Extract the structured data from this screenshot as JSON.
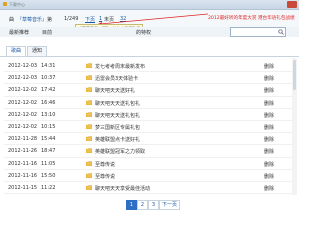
{
  "window": {
    "title": "下载中心"
  },
  "toolbar": {
    "category": "曲",
    "tag": "『草莓音乐』",
    "tag_suffix": "第",
    "page_text": "1/249",
    "prev": "下页",
    "next": "1",
    "last": "末页",
    "last_num": "32"
  },
  "annotation": {
    "red_note": "2012最好听的年度大赏 港台华语礼包战绩",
    "tooltip": "『草莓音乐』第1...单曲人民币购买"
  },
  "nav": {
    "left": "最新推荐",
    "middle": "目前",
    "right": "的特权"
  },
  "search": {
    "placeholder": ""
  },
  "tabs": [
    {
      "label": "歌曲"
    },
    {
      "label": "通知"
    }
  ],
  "rows": [
    {
      "date": "2012-12-03",
      "time": "14:31",
      "title": "龙七考考周末最新发布",
      "action": "删除"
    },
    {
      "date": "2012-12-03",
      "time": "10:37",
      "title": "迅雷会员3天体验卡",
      "action": "删除"
    },
    {
      "date": "2012-12-02",
      "time": "17:42",
      "title": "聊天吧天天送好礼",
      "action": "删除"
    },
    {
      "date": "2012-12-02",
      "time": "16:46",
      "title": "聊天吧天天送礼包礼",
      "action": "删除"
    },
    {
      "date": "2012-12-02",
      "time": "13:10",
      "title": "聊天吧天天送礼包礼",
      "action": "删除"
    },
    {
      "date": "2012-12-02",
      "time": "10:15",
      "title": "梦三国新区专属礼包",
      "action": "删除"
    },
    {
      "date": "2012-11-28",
      "time": "15:44",
      "title": "英雄联盟点卡送好礼",
      "action": "删除"
    },
    {
      "date": "2012-11-26",
      "time": "18:47",
      "title": "英雄联盟冠军之力领取",
      "action": "删除"
    },
    {
      "date": "2012-11-16",
      "time": "11:05",
      "title": "至尊传说",
      "action": "删除"
    },
    {
      "date": "2012-11-16",
      "time": "15:50",
      "title": "至尊传说",
      "action": "删除"
    },
    {
      "date": "2012-11-15",
      "time": "11:22",
      "title": "聊天吧天天享受最佳活动",
      "action": "删除"
    }
  ],
  "pagination": {
    "pages": [
      "1",
      "2",
      "3"
    ],
    "current": "1",
    "next": "下一页"
  },
  "colors": {
    "accent": "#2d6fc4",
    "annotation": "#e02222",
    "titlebar": "#d9e4ef"
  },
  "icons": [
    "folder-icon",
    "search-icon",
    "close-icon"
  ]
}
